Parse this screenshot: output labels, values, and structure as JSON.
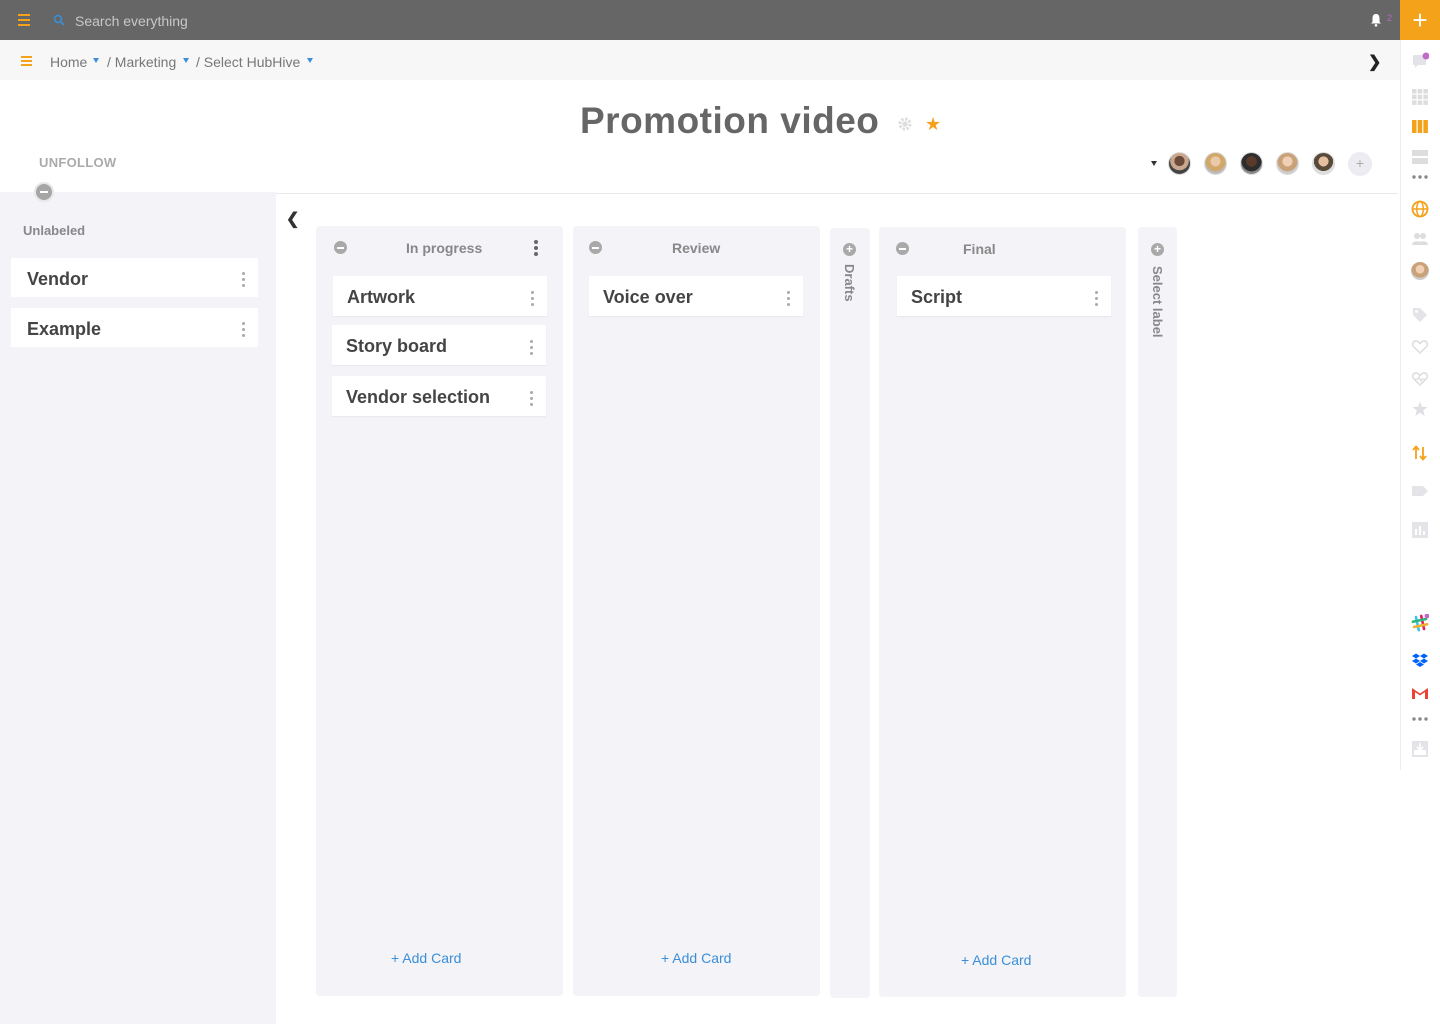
{
  "topbar": {
    "search_placeholder": "Search everything",
    "notification_count": "2",
    "add_label": "+"
  },
  "breadcrumb": {
    "items": [
      "Home",
      "/ Marketing",
      "/ Select HubHive"
    ]
  },
  "board": {
    "title": "Promotion video",
    "unfollow_label": "UNFOLLOW",
    "add_member_label": "+"
  },
  "left_panel": {
    "heading": "Unlabeled",
    "cards": [
      "Vendor",
      "Example"
    ]
  },
  "columns": [
    {
      "name": "In progress",
      "cards": [
        "Artwork",
        "Story board",
        "Vendor selection"
      ],
      "add_label": "+ Add Card"
    },
    {
      "name": "Review",
      "cards": [
        "Voice over"
      ],
      "add_label": "+ Add Card"
    },
    {
      "name": "Drafts",
      "collapsed": true
    },
    {
      "name": "Final",
      "cards": [
        "Script"
      ],
      "add_label": "+ Add Card"
    },
    {
      "name": "Select label",
      "collapsed": true
    }
  ],
  "colors": {
    "accent": "#f4a21a",
    "link": "#3a8fd8",
    "topbar": "#666666",
    "column_bg": "#f3f3f8"
  }
}
